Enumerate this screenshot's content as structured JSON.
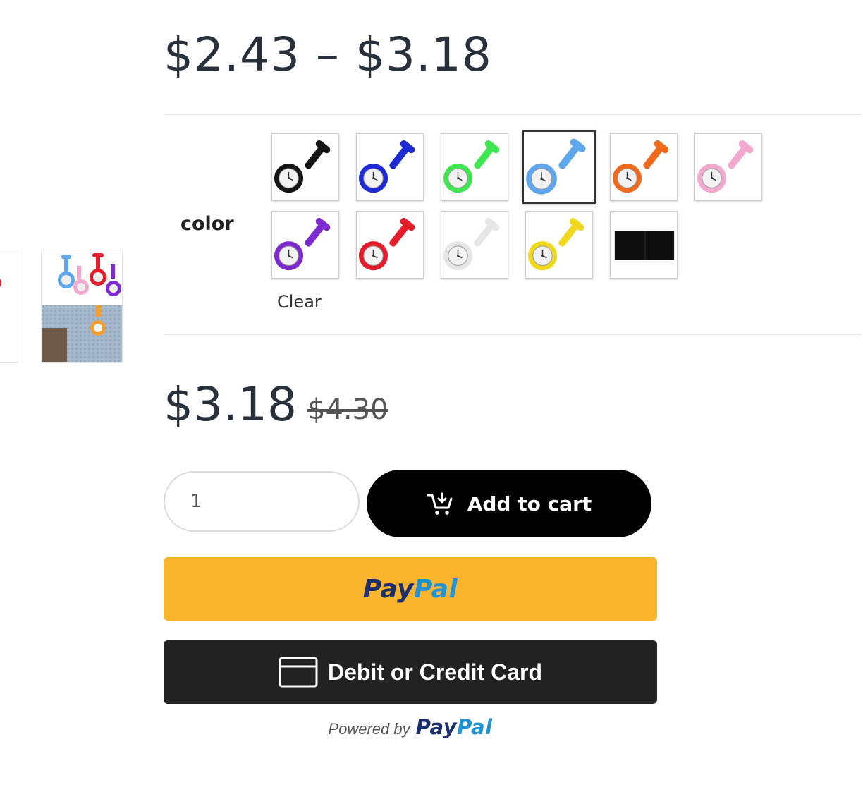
{
  "product": {
    "price_range": "$2.43 – $3.18",
    "sale_price": "$3.18",
    "regular_price": "$4.30"
  },
  "variation": {
    "label": "color",
    "clear_label": "Clear",
    "selected": "light-blue",
    "swatches": [
      {
        "name": "black",
        "color": "#151515"
      },
      {
        "name": "blue",
        "color": "#1c2bd4"
      },
      {
        "name": "green",
        "color": "#3ee650"
      },
      {
        "name": "light-blue",
        "color": "#5ea6ee"
      },
      {
        "name": "orange",
        "color": "#f06a1c"
      },
      {
        "name": "pink",
        "color": "#f3a8d0"
      },
      {
        "name": "purple",
        "color": "#7d2ad0"
      },
      {
        "name": "red",
        "color": "#e51c2a"
      },
      {
        "name": "white",
        "color": "#e6e6e6"
      },
      {
        "name": "yellow",
        "color": "#f0d81c"
      },
      {
        "name": "black-pouch",
        "color": "#0c0c0c"
      }
    ]
  },
  "cart": {
    "quantity": "1",
    "add_to_cart_label": "Add to cart",
    "add_to_cart_icon": "cart-plus-icon"
  },
  "paypal": {
    "pay": "Pay",
    "pal": "Pal",
    "card_label": "Debit or Credit Card",
    "card_icon": "credit-card-icon",
    "powered_by": "Powered by"
  },
  "colors": {
    "paypal_yellow": "#fbb52d",
    "paypal_dark_blue": "#1b2e6f",
    "paypal_light_blue": "#1f93d6",
    "card_button": "#222222",
    "cart_button": "#000000"
  }
}
